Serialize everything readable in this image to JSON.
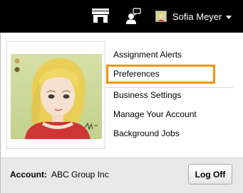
{
  "topbar": {
    "store_icon": "storefront-icon",
    "chat_icon": "person-chat-icon",
    "user_name": "Sofia Meyer",
    "caret_icon": "caret-down-icon"
  },
  "menu": {
    "items": [
      {
        "label": "Assignment Alerts"
      },
      {
        "label": "Preferences",
        "highlighted": true
      },
      {
        "label": "Business Settings"
      },
      {
        "label": "Manage Your Account"
      },
      {
        "label": "Background Jobs"
      }
    ]
  },
  "footer": {
    "account_label": "Account:",
    "account_name": "ABC Group Inc",
    "logoff_label": "Log Off"
  },
  "colors": {
    "topbar_bg": "#000000",
    "highlight_border": "#f0960e",
    "footer_bg": "#e9e9e9"
  }
}
